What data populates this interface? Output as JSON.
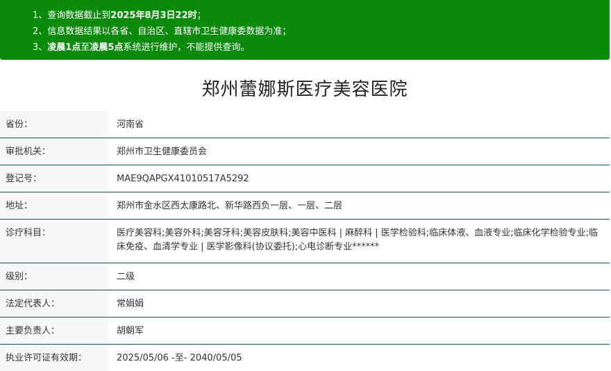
{
  "notice": {
    "line1": {
      "prefix": "1、查询数据截止到",
      "bold": "2025年8月3日22时",
      "suffix": "；"
    },
    "line2": {
      "text": "2、信息数据结果以各省、自治区、直辖市卫生健康委数据为准；"
    },
    "line3": {
      "prefix": "3、",
      "bold1": "凌晨1点",
      "mid": "至",
      "bold2": "凌晨5点",
      "suffix": "系统进行维护，不能提供查询。"
    }
  },
  "hospital_name": "郑州蕾娜斯医疗美容医院",
  "rows": [
    {
      "label": "省份：",
      "value": "河南省"
    },
    {
      "label": "审批机关：",
      "value": "郑州市卫生健康委员会"
    },
    {
      "label": "登记号：",
      "value": "MAE9QAPGX41010517A5292"
    },
    {
      "label": "地址：",
      "value": "郑州市金水区西太康路北、新华路西负一层、一层、二层"
    },
    {
      "label": "诊疗科目：",
      "value": "医疗美容科;美容外科;美容牙科;美容皮肤科;美容中医科 | 麻醉科 | 医学检验科;临床体液、血液专业;临床化学检验专业;临床免疫、血清学专业 | 医学影像科(协议委托);心电诊断专业******"
    },
    {
      "label": "级别：",
      "value": "二级"
    },
    {
      "label": "法定代表人：",
      "value": "常娟娟"
    },
    {
      "label": "主要负责人：",
      "value": "胡朝军"
    },
    {
      "label": "执业许可证有效期：",
      "value": "2025/05/06 -至- 2040/05/05"
    }
  ]
}
